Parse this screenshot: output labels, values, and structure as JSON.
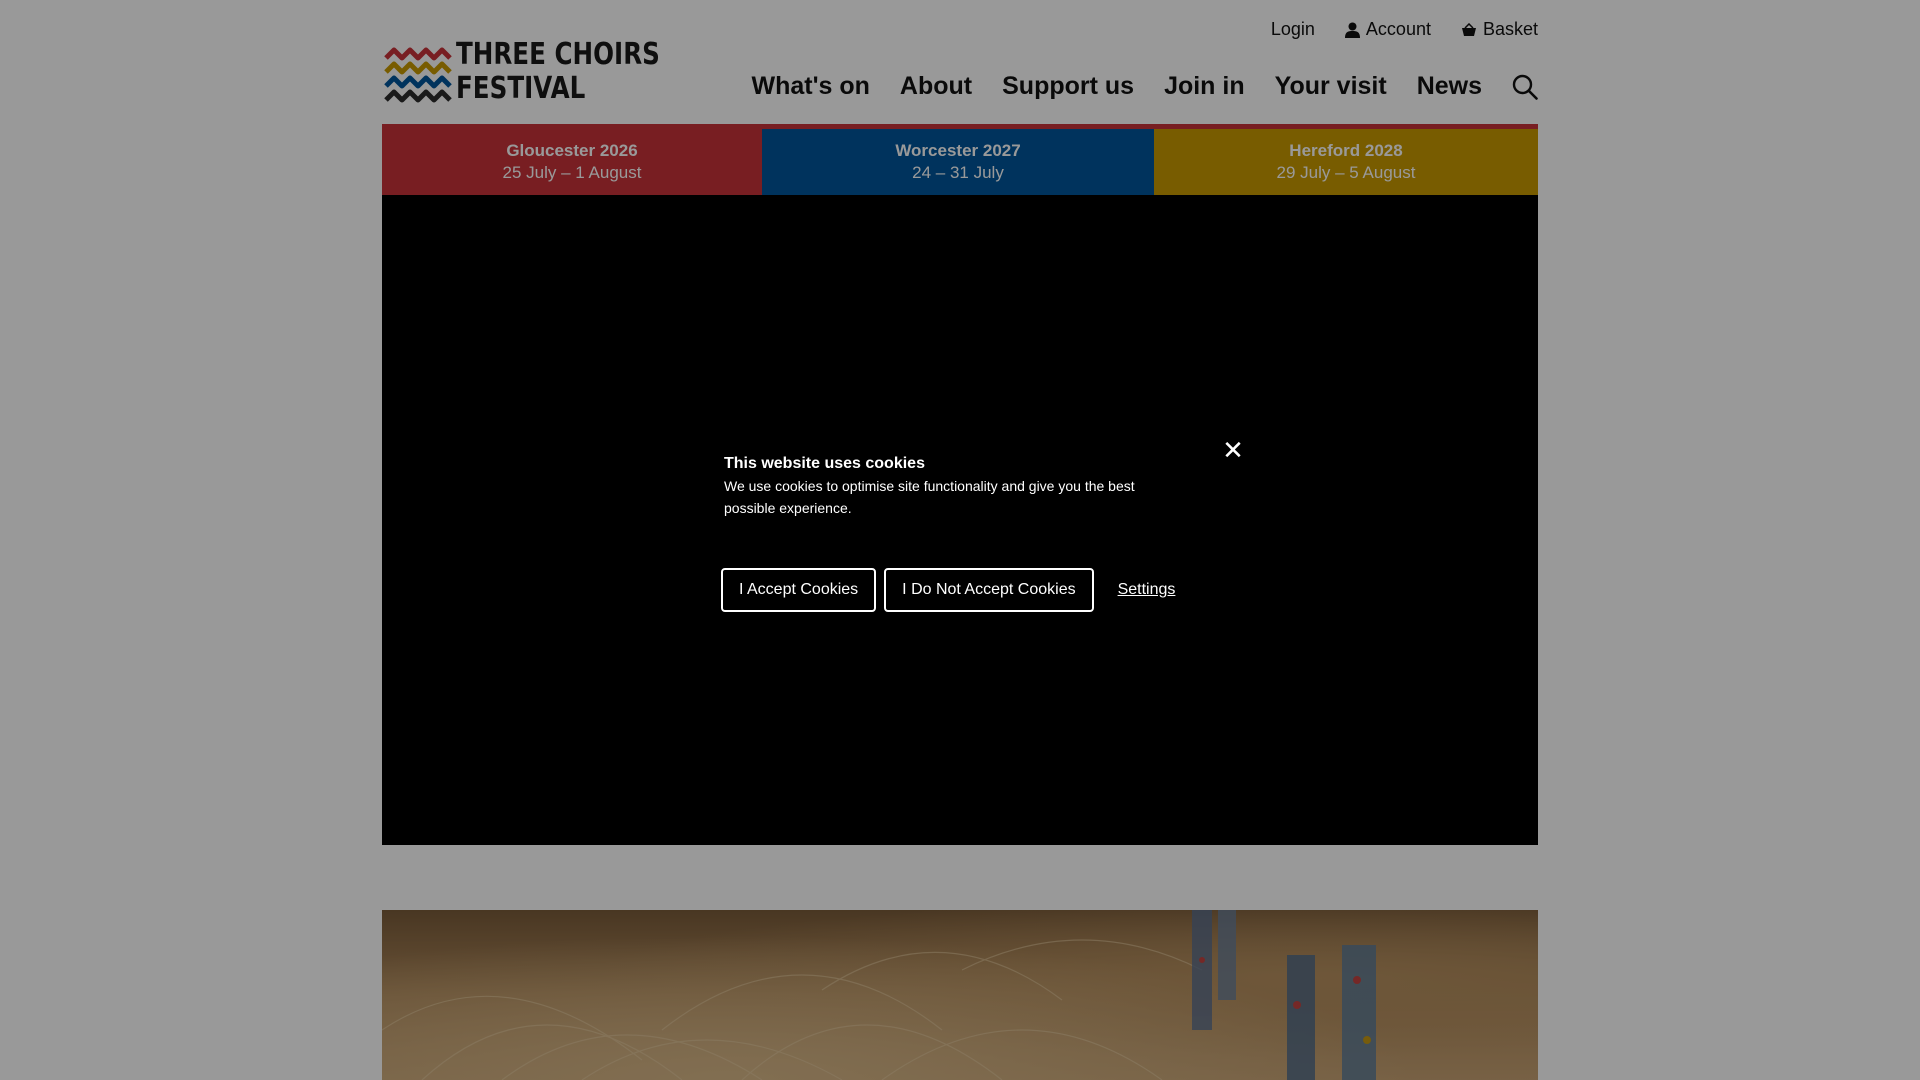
{
  "header": {
    "logo_text_line1": "THREE CHOIRS",
    "logo_text_line2": "FESTIVAL",
    "util_nav": {
      "login": "Login",
      "account": "Account",
      "basket": "Basket"
    },
    "main_nav": [
      "What's on",
      "About",
      "Support us",
      "Join in",
      "Your visit",
      "News"
    ]
  },
  "festivals": [
    {
      "name": "Gloucester 2026",
      "dates": "25 July – 1 August",
      "color": "#c8323a"
    },
    {
      "name": "Worcester 2027",
      "dates": "24 – 31 July",
      "color": "#00569b"
    },
    {
      "name": "Hereford 2028",
      "dates": "29 July – 5 August",
      "color": "#c99a00"
    }
  ],
  "cookie_banner": {
    "title": "This website uses cookies",
    "text": "We use cookies to optimise site functionality and give you the best possible experience.",
    "accept_label": "I Accept Cookies",
    "decline_label": "I Do Not Accept Cookies",
    "settings_label": "Settings",
    "close_glyph": "✕"
  },
  "icons": {
    "user": "user-icon",
    "basket": "basket-icon",
    "search": "search-icon",
    "close": "close-icon"
  }
}
